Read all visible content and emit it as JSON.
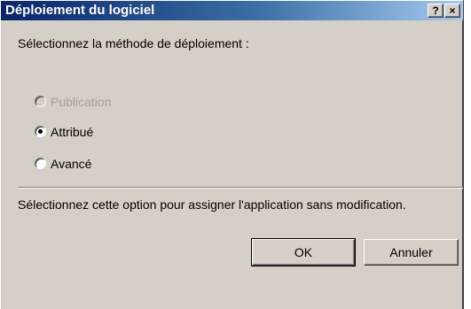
{
  "window": {
    "title": "Déploiement du logiciel",
    "help_label": "?",
    "close_label": "×"
  },
  "prompt": "Sélectionnez la méthode de déploiement :",
  "options": [
    {
      "label": "Publication",
      "enabled": false,
      "selected": false
    },
    {
      "label": "Attribué",
      "enabled": true,
      "selected": true
    },
    {
      "label": "Avancé",
      "enabled": true,
      "selected": false
    }
  ],
  "description": "Sélectionnez cette option pour assigner l'application sans modification.",
  "buttons": {
    "ok": "OK",
    "cancel": "Annuler"
  },
  "colors": {
    "titlebar_start": "#0a246a",
    "titlebar_end": "#a6caf0",
    "face": "#d4d0c8",
    "disabled_text": "#a0a0a0"
  }
}
